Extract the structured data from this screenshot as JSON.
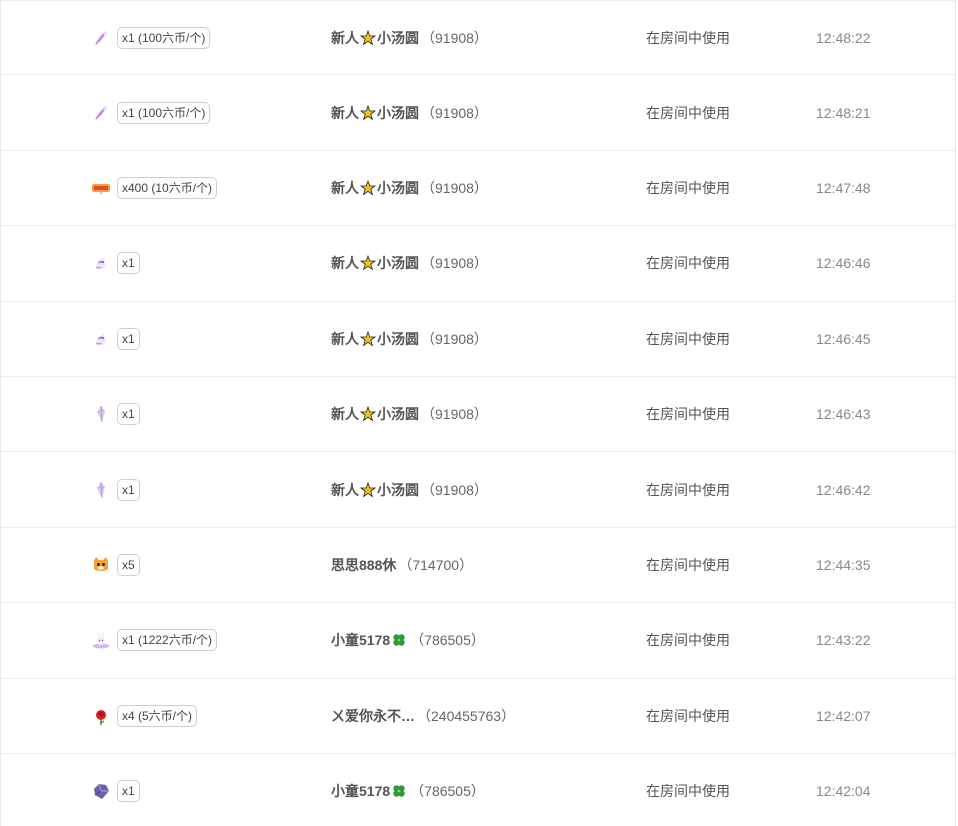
{
  "rows": [
    {
      "icon": "feather-gift-icon",
      "qty": "x1 (100六币/个)",
      "name_a": "新人",
      "badge": "star-badge-icon",
      "name_b": "小汤圆",
      "uid": "（91908）",
      "usage": "在房间中使用",
      "time": "12:48:22"
    },
    {
      "icon": "feather-gift-icon",
      "qty": "x1 (100六币/个)",
      "name_a": "新人",
      "badge": "star-badge-icon",
      "name_b": "小汤圆",
      "uid": "（91908）",
      "usage": "在房间中使用",
      "time": "12:48:21"
    },
    {
      "icon": "banner-gift-icon",
      "qty": "x400 (10六币/个)",
      "name_a": "新人",
      "badge": "star-badge-icon",
      "name_b": "小汤圆",
      "uid": "（91908）",
      "usage": "在房间中使用",
      "time": "12:47:48"
    },
    {
      "icon": "unicorn-gift-icon",
      "qty": "x1",
      "name_a": "新人",
      "badge": "star-badge-icon",
      "name_b": "小汤圆",
      "uid": "（91908）",
      "usage": "在房间中使用",
      "time": "12:46:46"
    },
    {
      "icon": "unicorn-gift-icon",
      "qty": "x1",
      "name_a": "新人",
      "badge": "star-badge-icon",
      "name_b": "小汤圆",
      "uid": "（91908）",
      "usage": "在房间中使用",
      "time": "12:46:45"
    },
    {
      "icon": "crystal-gift-icon",
      "qty": "x1",
      "name_a": "新人",
      "badge": "star-badge-icon",
      "name_b": "小汤圆",
      "uid": "（91908）",
      "usage": "在房间中使用",
      "time": "12:46:43"
    },
    {
      "icon": "crystal-gift-icon",
      "qty": "x1",
      "name_a": "新人",
      "badge": "star-badge-icon",
      "name_b": "小汤圆",
      "uid": "（91908）",
      "usage": "在房间中使用",
      "time": "12:46:42"
    },
    {
      "icon": "cat-gift-icon",
      "qty": "x5",
      "name_a": "思思888休",
      "badge": "",
      "name_b": "",
      "uid": "（714700）",
      "usage": "在房间中使用",
      "time": "12:44:35"
    },
    {
      "icon": "bunny-gift-icon",
      "qty": "x1 (1222六币/个)",
      "name_a": "小童5178",
      "badge": "clover-icon",
      "name_b": "",
      "uid": "（786505）",
      "usage": "在房间中使用",
      "time": "12:43:22"
    },
    {
      "icon": "rose-gift-icon",
      "qty": "x4 (5六币/个)",
      "name_a": "ㄨ爱你永不…",
      "badge": "",
      "name_b": "",
      "uid": "（240455763）",
      "usage": "在房间中使用",
      "time": "12:42:07"
    },
    {
      "icon": "gem-gift-icon",
      "qty": "x1",
      "name_a": "小童5178",
      "badge": "clover-icon",
      "name_b": "",
      "uid": "（786505）",
      "usage": "在房间中使用",
      "time": "12:42:04"
    }
  ],
  "colors": {
    "border": "#ececec",
    "text": "#555555",
    "time": "#888888",
    "badge_border": "#cfcfcf"
  }
}
